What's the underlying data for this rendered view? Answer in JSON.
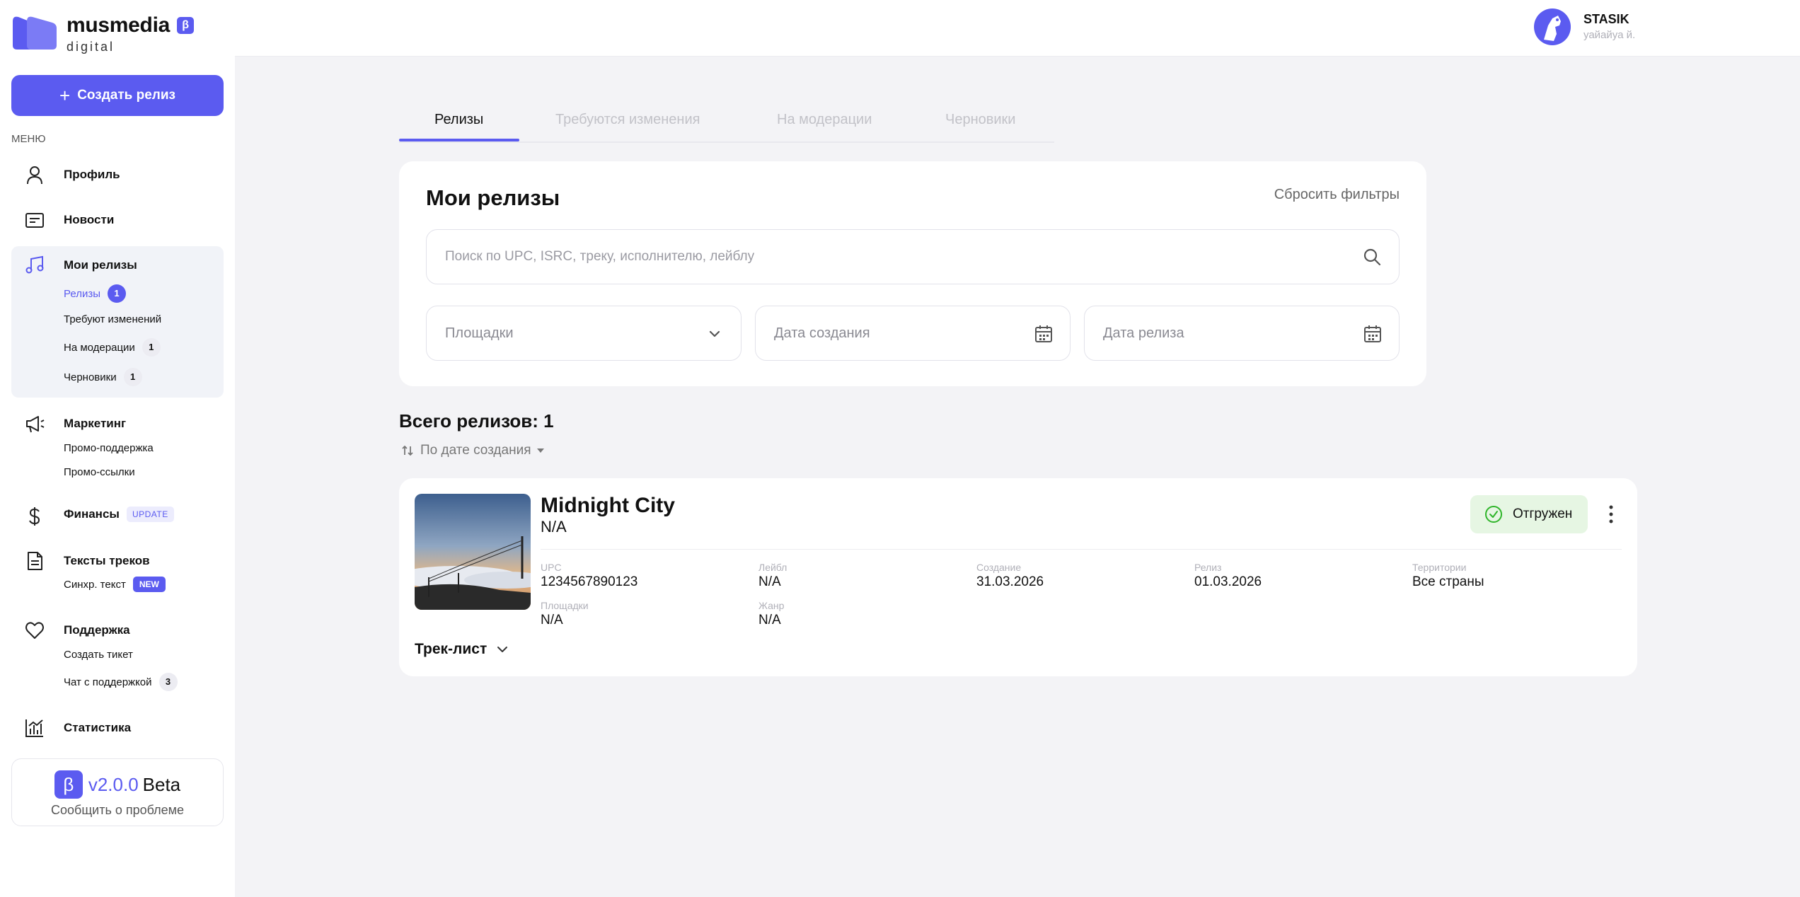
{
  "brand": {
    "name": "musmedia",
    "beta_mark": "β",
    "sub": "digital",
    "accent": "#5b5bf0"
  },
  "sidebar": {
    "create_button": "Создать релиз",
    "create_plus": "+",
    "menu_label": "МЕНЮ",
    "profile": "Профиль",
    "news": "Новости",
    "releases": {
      "label": "Мои релизы",
      "items": [
        {
          "label": "Релизы",
          "count": "1"
        },
        {
          "label": "Требуют изменений"
        },
        {
          "label": "На модерации",
          "count": "1"
        },
        {
          "label": "Черновики",
          "count": "1"
        }
      ]
    },
    "marketing": {
      "label": "Маркетинг",
      "items": [
        "Промо-поддержка",
        "Промо-ссылки"
      ]
    },
    "finance": {
      "label": "Финансы",
      "tag": "UPDATE"
    },
    "lyrics": {
      "label": "Тексты треков",
      "sub": "Синхр. текст",
      "tag": "NEW"
    },
    "support": {
      "label": "Поддержка",
      "create_ticket": "Создать тикет",
      "chat": "Чат с поддержкой",
      "chat_count": "3"
    },
    "stats": "Статистика",
    "version": {
      "badge": "β",
      "number": "v2.0.0",
      "word": "Beta",
      "report": "Сообщить о проблеме"
    }
  },
  "header": {
    "user_name": "STASIK",
    "user_sub": "уайайуа й."
  },
  "tabs": [
    "Релизы",
    "Требуются изменения",
    "На модерации",
    "Черновики"
  ],
  "filters": {
    "title": "Мои релизы",
    "reset": "Сбросить фильтры",
    "search_placeholder": "Поиск по UPC, ISRC, треку, исполнителю, лейблу",
    "platforms": "Площадки",
    "created_date": "Дата создания",
    "release_date": "Дата релиза"
  },
  "list": {
    "total": "Всего релизов: 1",
    "sort": "По дате создания"
  },
  "release": {
    "title": "Midnight City",
    "artist": "N/A",
    "status": "Отгружен",
    "status_color": "#2fb52a",
    "meta": {
      "upc_label": "UPC",
      "upc": "1234567890123",
      "label_label": "Лейбл",
      "label": "N/A",
      "created_label": "Создание",
      "created": "31.03.2026",
      "release_label": "Релиз",
      "release": "01.03.2026",
      "territory_label": "Территории",
      "territory": "Все страны",
      "platforms_label": "Площадки",
      "platforms": "N/A",
      "genre_label": "Жанр",
      "genre": "N/A"
    },
    "tracklist": "Трек-лист"
  }
}
